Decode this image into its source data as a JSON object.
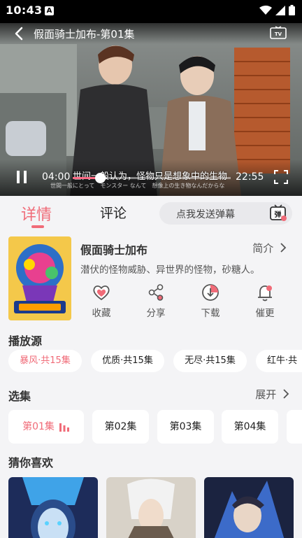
{
  "status_bar": {
    "time": "10:43",
    "badge": "A"
  },
  "player": {
    "title": "假面骑士加布-第01集",
    "current_time": "04:00",
    "duration": "22:55",
    "progress_fraction": 0.173,
    "subtitle": "世间一般认为，怪物只是想象中的生物",
    "subtitle_jp": "世間一般にとって　モンスター なんて　想像上の生き物なんだからな"
  },
  "tabs": {
    "details": "详情",
    "comments": "评论"
  },
  "danmaku": {
    "placeholder": "点我发送弹幕",
    "icon_label": "弹"
  },
  "show": {
    "title": "假面骑士加布",
    "intro_link": "简介",
    "description": "潜伏的怪物威胁、异世界的怪物，砂糖人。"
  },
  "actions": [
    {
      "label": "收藏",
      "icon": "heart-icon"
    },
    {
      "label": "分享",
      "icon": "share-icon"
    },
    {
      "label": "下载",
      "icon": "download-icon"
    },
    {
      "label": "催更",
      "icon": "bell-icon"
    }
  ],
  "sources": {
    "title": "播放源",
    "items": [
      {
        "label": "暴风·共15集",
        "active": true
      },
      {
        "label": "优质·共15集",
        "active": false
      },
      {
        "label": "无尽·共15集",
        "active": false
      },
      {
        "label": "红牛·共",
        "active": false
      }
    ]
  },
  "episodes": {
    "title": "选集",
    "expand": "展开",
    "items": [
      {
        "label": "第01集",
        "active": true
      },
      {
        "label": "第02集",
        "active": false
      },
      {
        "label": "第03集",
        "active": false
      },
      {
        "label": "第04集",
        "active": false
      }
    ]
  },
  "recommend": {
    "title": "猜你喜欢"
  },
  "colors": {
    "accent": "#f06b78",
    "background": "#f4f4f6",
    "chip_bg": "#ffffff"
  }
}
